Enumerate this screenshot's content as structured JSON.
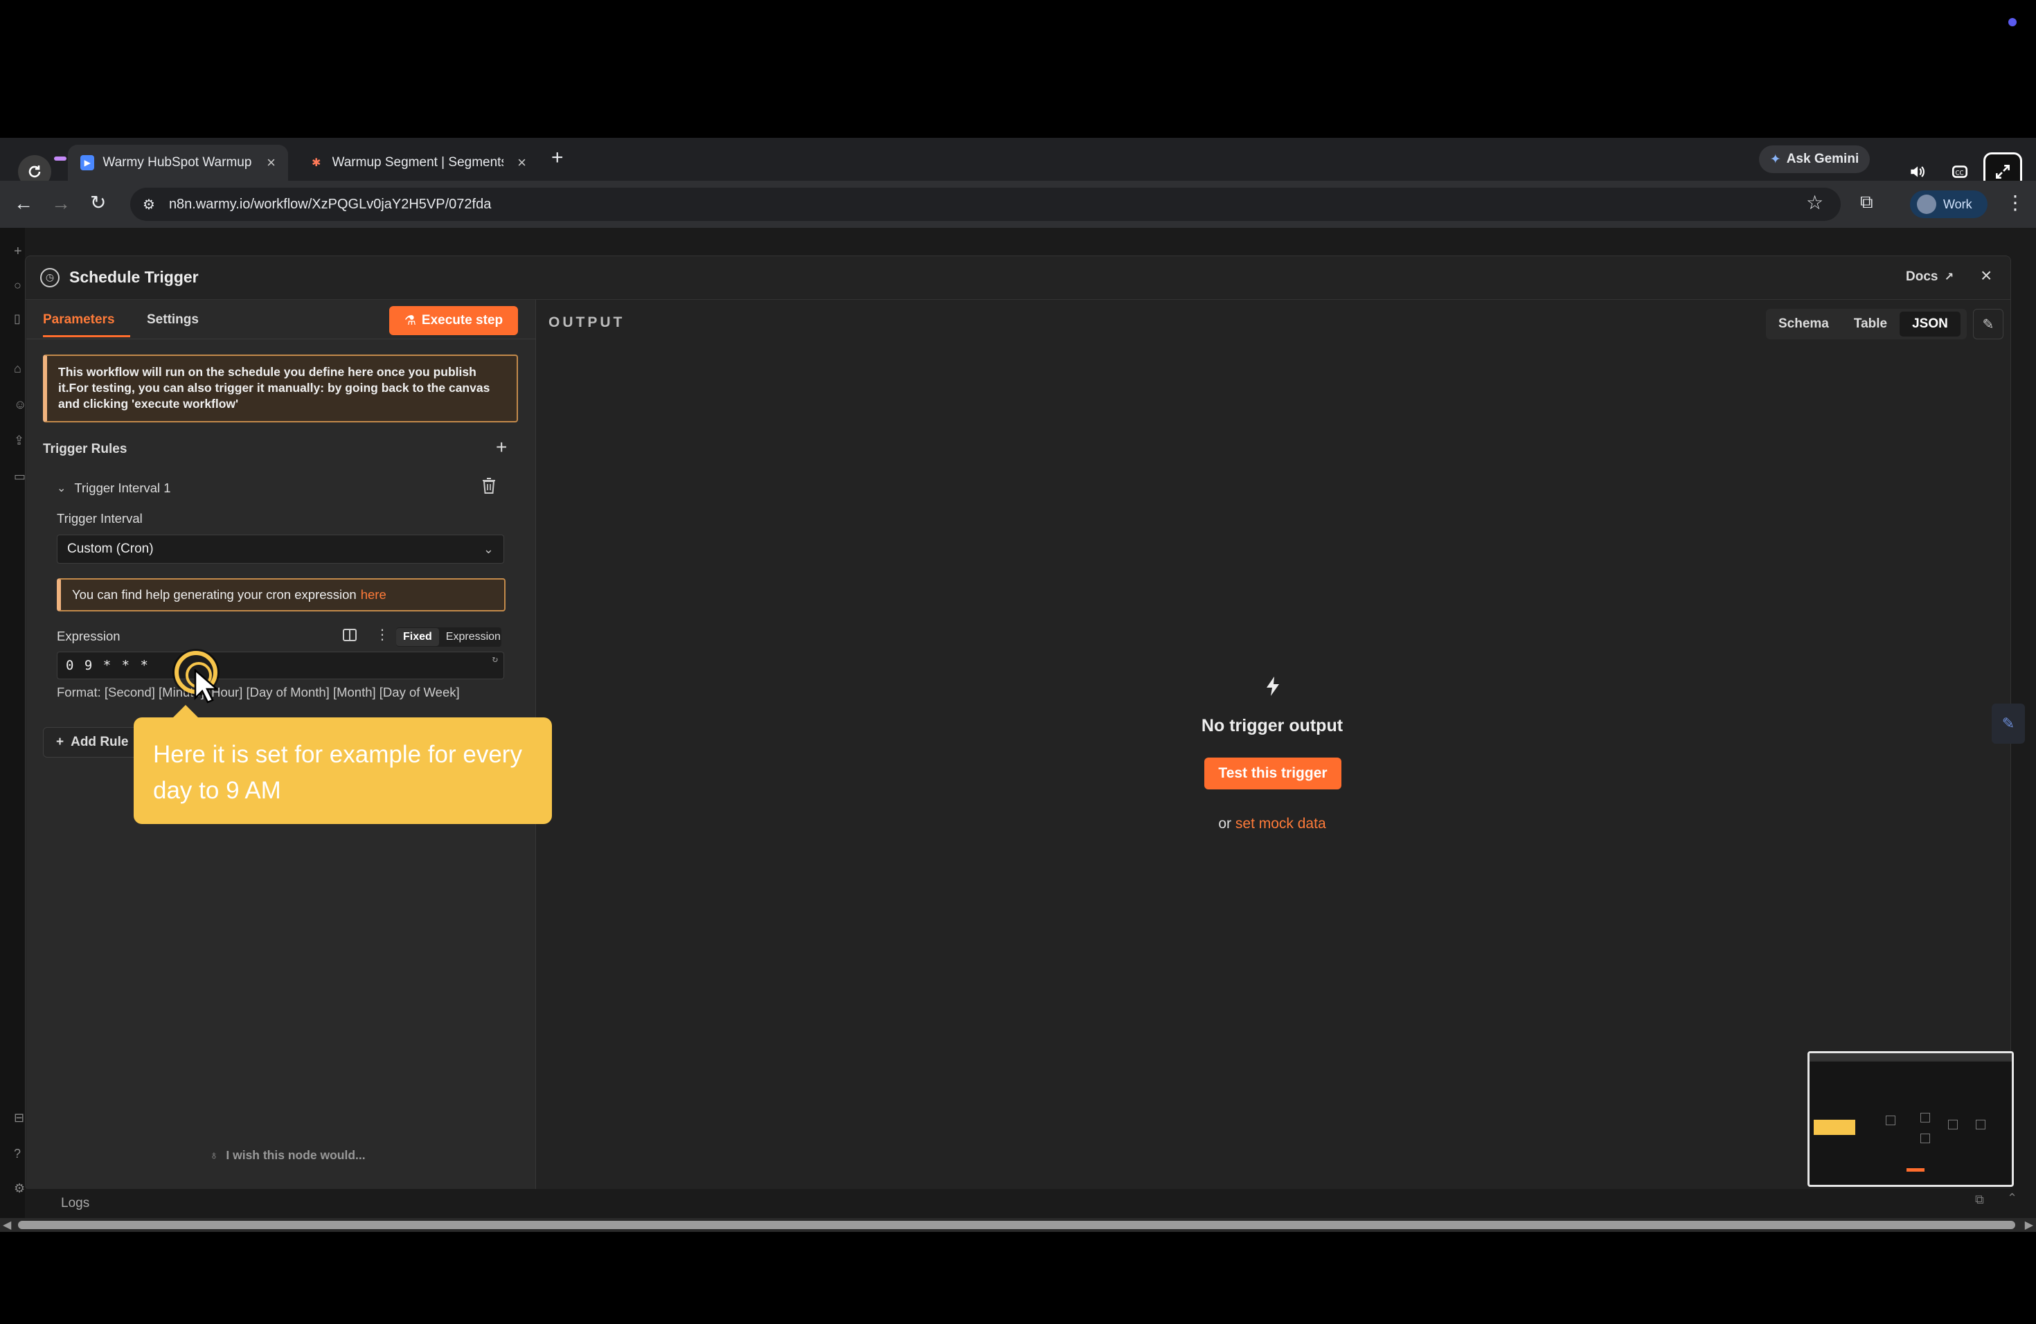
{
  "browser": {
    "tabs": [
      {
        "title": "Warmy HubSpot Warmup R",
        "active": true
      },
      {
        "title": "Warmup Segment | Segments",
        "active": false
      }
    ],
    "url": "n8n.warmy.io/workflow/XzPQGLv0jaY2H5VP/072fda",
    "gemini_label": "Ask Gemini",
    "profile_label": "Work"
  },
  "node": {
    "title": "Schedule Trigger",
    "docs_label": "Docs",
    "tabs": {
      "parameters": "Parameters",
      "settings": "Settings"
    },
    "execute_label": "Execute step",
    "notice": "This workflow will run on the schedule you define here once you publish it.For testing, you can also trigger it manually: by going back to the canvas and clicking 'execute workflow'",
    "trigger_rules_label": "Trigger Rules",
    "interval_item_label": "Trigger Interval 1",
    "trigger_interval_label": "Trigger Interval",
    "trigger_interval_value": "Custom (Cron)",
    "cron_hint": "You can find help generating your cron expression",
    "cron_hint_link": "here",
    "expression_label": "Expression",
    "mode_fixed": "Fixed",
    "mode_expression": "Expression",
    "expression_value": "0 9 * * *",
    "format_text": "Format: [Second] [Minute] [Hour] [Day of Month] [Month] [Day of Week]",
    "add_rule_label": "Add Rule",
    "wish_label": "I wish this node would..."
  },
  "output": {
    "label": "OUTPUT",
    "views": [
      "Schema",
      "Table",
      "JSON"
    ],
    "selected_view": "JSON",
    "empty_title": "No trigger output",
    "test_label": "Test this trigger",
    "mock_prefix": "or",
    "mock_link": "set mock data"
  },
  "logs_label": "Logs",
  "tooltip": "Here it is set for example for every day to 9 AM",
  "colors": {
    "accent": "#ff6d2d",
    "tooltip": "#f7c54b",
    "notice_border": "#c38a4b"
  }
}
